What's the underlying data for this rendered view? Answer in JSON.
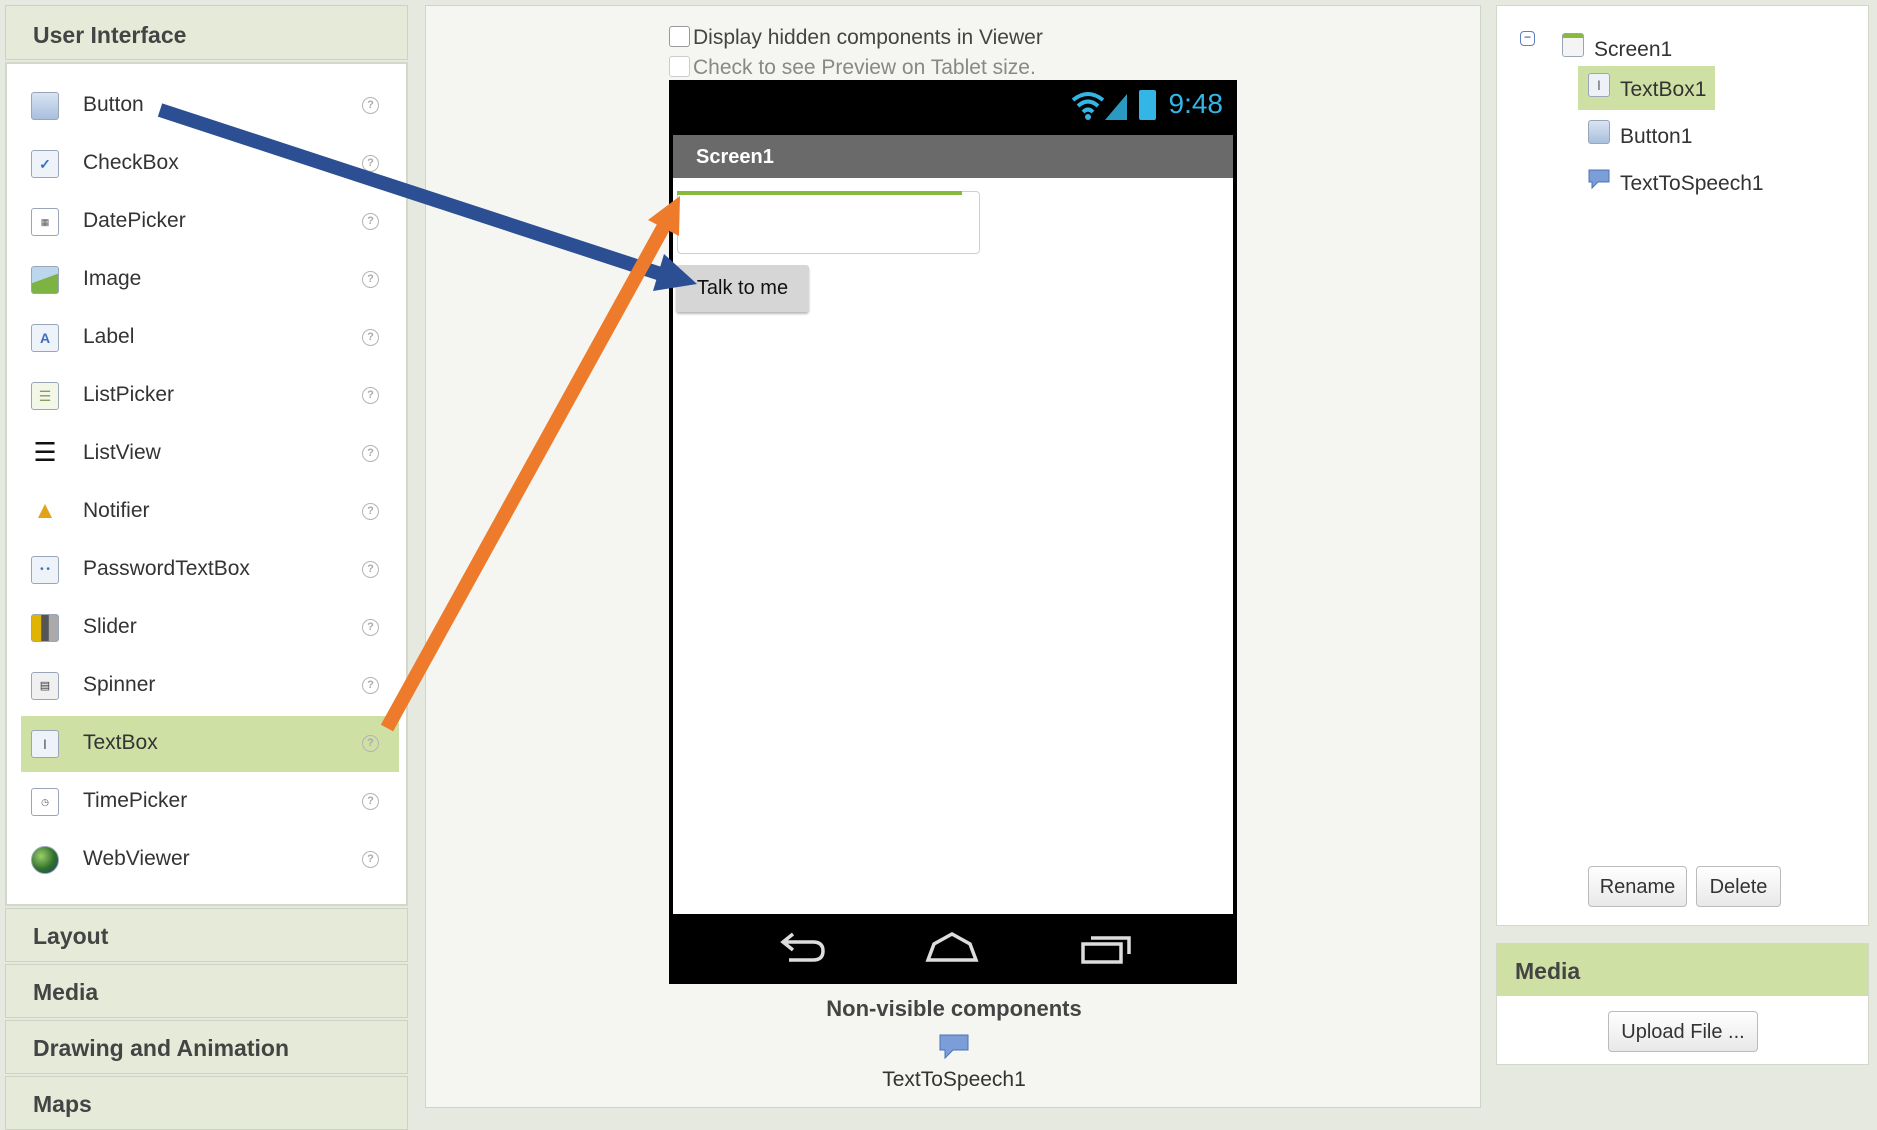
{
  "palette": {
    "header": "User Interface",
    "items": [
      {
        "label": "Button",
        "icon": "button-icon"
      },
      {
        "label": "CheckBox",
        "icon": "checkbox-icon"
      },
      {
        "label": "DatePicker",
        "icon": "datepicker-icon"
      },
      {
        "label": "Image",
        "icon": "image-icon"
      },
      {
        "label": "Label",
        "icon": "label-icon"
      },
      {
        "label": "ListPicker",
        "icon": "listpicker-icon"
      },
      {
        "label": "ListView",
        "icon": "listview-icon"
      },
      {
        "label": "Notifier",
        "icon": "notifier-icon"
      },
      {
        "label": "PasswordTextBox",
        "icon": "passwordtextbox-icon"
      },
      {
        "label": "Slider",
        "icon": "slider-icon"
      },
      {
        "label": "Spinner",
        "icon": "spinner-icon"
      },
      {
        "label": "TextBox",
        "icon": "textbox-icon",
        "selected": true
      },
      {
        "label": "TimePicker",
        "icon": "timepicker-icon"
      },
      {
        "label": "WebViewer",
        "icon": "webviewer-icon"
      }
    ],
    "help_glyph": "?",
    "drawers": [
      "Layout",
      "Media",
      "Drawing and Animation",
      "Maps"
    ]
  },
  "viewer": {
    "hidden_components_label": "Display hidden components in Viewer",
    "tablet_preview_label": "Check to see Preview on Tablet size.",
    "phone": {
      "clock": "9:48",
      "screen_title": "Screen1",
      "button_text": "Talk to me"
    },
    "non_visible_title": "Non-visible components",
    "non_visible_items": [
      "TextToSpeech1"
    ]
  },
  "components": {
    "tree": [
      {
        "label": "Screen1",
        "icon": "screen-icon",
        "level": 0
      },
      {
        "label": "TextBox1",
        "icon": "textbox-icon",
        "level": 1,
        "selected": true
      },
      {
        "label": "Button1",
        "icon": "button-icon",
        "level": 1
      },
      {
        "label": "TextToSpeech1",
        "icon": "texttospeech-icon",
        "level": 1
      }
    ],
    "toggle_glyph": "−",
    "rename_label": "Rename",
    "delete_label": "Delete"
  },
  "media": {
    "header": "Media",
    "upload_label": "Upload File ..."
  },
  "colors": {
    "selection": "#cfe0a4",
    "status_blue": "#33b5e5",
    "arrow_blue": "#2c4f94",
    "arrow_orange": "#ee7b2c",
    "textbox_focus": "#86b93c"
  }
}
